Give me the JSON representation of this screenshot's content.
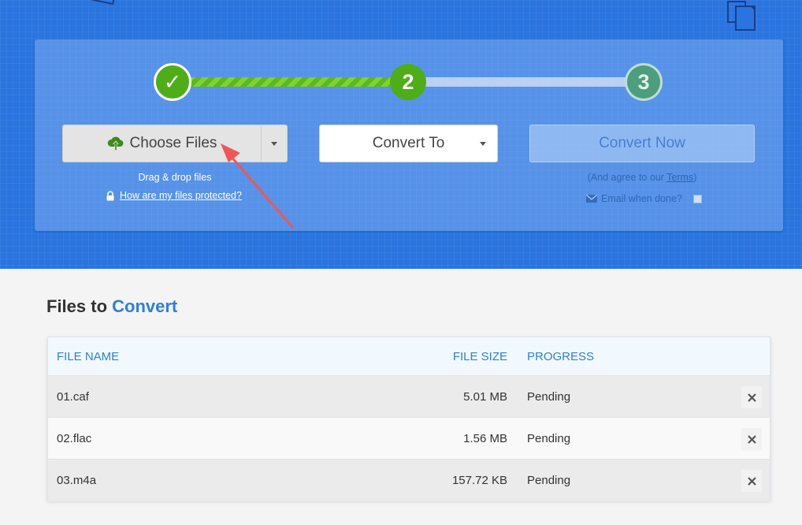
{
  "steps": {
    "step1_symbol": "✓",
    "step2_label": "2",
    "step3_label": "3"
  },
  "upload": {
    "choose_files_label": "Choose Files",
    "drag_drop_text": "Drag & drop files",
    "protection_link": "How are my files protected?"
  },
  "convert": {
    "convert_to_label": "Convert To",
    "convert_now_label": "Convert Now",
    "agree_prefix": "(And agree to our ",
    "terms_link": "Terms",
    "agree_suffix": ")",
    "email_label": "Email when done?"
  },
  "files": {
    "title_prefix": "Files to ",
    "title_accent": "Convert",
    "headers": {
      "name": "FILE NAME",
      "size": "FILE SIZE",
      "progress": "PROGRESS"
    },
    "rows": [
      {
        "name": "01.caf",
        "size": "5.01 MB",
        "progress": "Pending"
      },
      {
        "name": "02.flac",
        "size": "1.56 MB",
        "progress": "Pending"
      },
      {
        "name": "03.m4a",
        "size": "157.72 KB",
        "progress": "Pending"
      }
    ]
  },
  "colors": {
    "hero_blue": "#2a74df",
    "step_green": "#4fad17",
    "accent_blue": "#2f7fd6",
    "annotation_red": "#f25555"
  },
  "icons": {
    "upload": "cloud-upload-icon",
    "lock": "lock-icon",
    "email": "envelope-icon",
    "remove": "close-icon",
    "dropdown": "caret-down-icon"
  }
}
